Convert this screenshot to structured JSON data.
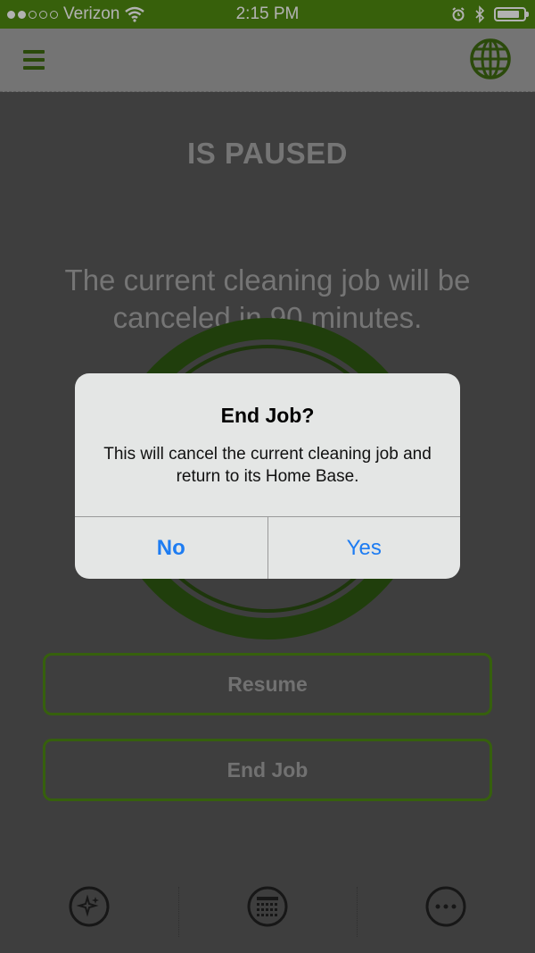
{
  "status_bar": {
    "carrier": "Verizon",
    "time": "2:15 PM",
    "signal_bars_filled": 2,
    "signal_bars_total": 5,
    "battery_level": 0.85,
    "icons": [
      "wifi-icon",
      "alarm-icon",
      "bluetooth-icon",
      "battery-icon"
    ]
  },
  "nav": {
    "menu_icon": "hamburger-menu-icon",
    "globe_icon": "globe-icon"
  },
  "main": {
    "status_title": "IS PAUSED",
    "cancel_message": "The current cleaning job will be canceled in 90 minutes.",
    "resume_label": "Resume",
    "end_job_label": "End Job"
  },
  "tab_bar": {
    "items": [
      {
        "icon": "sparkle-clean-icon"
      },
      {
        "icon": "calendar-schedule-icon"
      },
      {
        "icon": "more-options-icon"
      }
    ]
  },
  "alert": {
    "title": "End Job?",
    "message": "This will cancel the current cleaning job and return  to its Home Base.",
    "no_label": "No",
    "yes_label": "Yes"
  },
  "colors": {
    "brand_green": "#4f8a10",
    "alert_button_blue": "#1d7cf2",
    "nav_background": "#a6a6a6",
    "content_background": "#595959"
  }
}
